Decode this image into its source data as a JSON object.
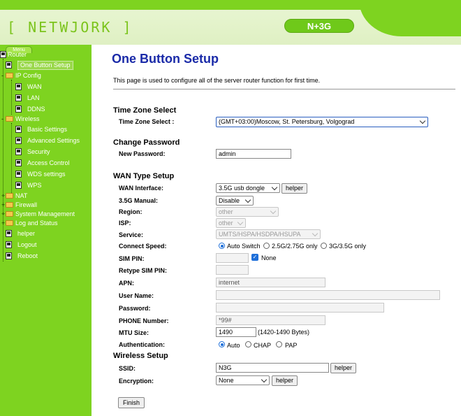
{
  "header": {
    "logo": "[ NETWJORK ]",
    "model": "N+3G"
  },
  "sidebar": {
    "menu_tab": "Menu",
    "root": "Router",
    "items": [
      {
        "label": "One Button Setup"
      },
      {
        "label": "IP Config"
      },
      {
        "label": "WAN"
      },
      {
        "label": "LAN"
      },
      {
        "label": "DDNS"
      },
      {
        "label": "Wireless"
      },
      {
        "label": "Basic Settings"
      },
      {
        "label": "Advanced Settings"
      },
      {
        "label": "Security"
      },
      {
        "label": "Access Control"
      },
      {
        "label": "WDS settings"
      },
      {
        "label": "WPS"
      },
      {
        "label": "NAT"
      },
      {
        "label": "Firewall"
      },
      {
        "label": "System Management"
      },
      {
        "label": "Log and Status"
      },
      {
        "label": "helper"
      },
      {
        "label": "Logout"
      },
      {
        "label": "Reboot"
      }
    ]
  },
  "main": {
    "title": "One Button Setup",
    "description": "This page is used to configure all of the server router function for first time.",
    "timezone": {
      "heading": "Time Zone Select",
      "label": "Time Zone Select :",
      "value": "(GMT+03:00)Moscow, St. Petersburg, Volgograd"
    },
    "password": {
      "heading": "Change Password",
      "label": "New Password:",
      "value": "admin"
    },
    "wan": {
      "heading": "WAN Type Setup",
      "interface_label": "WAN Interface:",
      "interface_value": "3.5G usb dongle",
      "helper_label": "helper",
      "manual_label": "3.5G Manual:",
      "manual_value": "Disable",
      "region_label": "Region:",
      "region_value": "other",
      "isp_label": "ISP:",
      "isp_value": "other",
      "service_label": "Service:",
      "service_value": "UMTS/HSPA/HSDPA/HSUPA",
      "speed_label": "Connect Speed:",
      "speed_options": [
        "Auto Switch",
        "2.5G/2.75G only",
        "3G/3.5G only"
      ],
      "sim_pin_label": "SIM PIN:",
      "sim_pin_none": "None",
      "retype_pin_label": "Retype SIM PIN:",
      "apn_label": "APN:",
      "apn_value": "internet",
      "username_label": "User Name:",
      "password_label": "Password:",
      "phone_label": "PHONE Number:",
      "phone_value": "*99#",
      "mtu_label": "MTU Size:",
      "mtu_value": "1490",
      "mtu_hint": "(1420-1490 Bytes)",
      "auth_label": "Authentication:",
      "auth_options": [
        "Auto",
        "CHAP",
        "PAP"
      ]
    },
    "wireless": {
      "heading": "Wireless Setup",
      "ssid_label": "SSID:",
      "ssid_value": "N3G",
      "helper_label": "helper",
      "encryption_label": "Encryption:",
      "encryption_value": "None",
      "encryption_helper_label": "helper"
    },
    "finish_label": "Finish"
  }
}
